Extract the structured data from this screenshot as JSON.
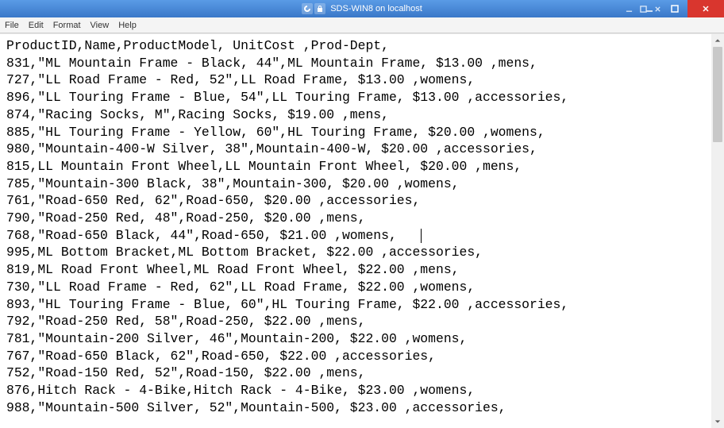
{
  "window": {
    "title": "SDS-WIN8 on localhost"
  },
  "menubar": {
    "items": [
      "File",
      "Edit",
      "Format",
      "View",
      "Help"
    ]
  },
  "csv": {
    "header": [
      "ProductID",
      "Name",
      "ProductModel",
      " UnitCost ",
      "Prod-Dept",
      ""
    ],
    "rows": [
      {
        "id": "831",
        "name": "ML Mountain Frame - Black, 44",
        "nameQuoted": true,
        "model": "ML Mountain Frame",
        "cost": "$13.00",
        "dept": "mens"
      },
      {
        "id": "727",
        "name": "LL Road Frame - Red, 52",
        "nameQuoted": true,
        "model": "LL Road Frame",
        "cost": "$13.00",
        "dept": "womens"
      },
      {
        "id": "896",
        "name": "LL Touring Frame - Blue, 54",
        "nameQuoted": true,
        "model": "LL Touring Frame",
        "cost": "$13.00",
        "dept": "accessories"
      },
      {
        "id": "874",
        "name": "Racing Socks, M",
        "nameQuoted": true,
        "model": "Racing Socks",
        "cost": "$19.00",
        "dept": "mens"
      },
      {
        "id": "885",
        "name": "HL Touring Frame - Yellow, 60",
        "nameQuoted": true,
        "model": "HL Touring Frame",
        "cost": "$20.00",
        "dept": "womens"
      },
      {
        "id": "980",
        "name": "Mountain-400-W Silver, 38",
        "nameQuoted": true,
        "model": "Mountain-400-W",
        "cost": "$20.00",
        "dept": "accessories"
      },
      {
        "id": "815",
        "name": "LL Mountain Front Wheel",
        "nameQuoted": false,
        "model": "LL Mountain Front Wheel",
        "cost": "$20.00",
        "dept": "mens"
      },
      {
        "id": "785",
        "name": "Mountain-300 Black, 38",
        "nameQuoted": true,
        "model": "Mountain-300",
        "cost": "$20.00",
        "dept": "womens"
      },
      {
        "id": "761",
        "name": "Road-650 Red, 62",
        "nameQuoted": true,
        "model": "Road-650",
        "cost": "$20.00",
        "dept": "accessories"
      },
      {
        "id": "790",
        "name": "Road-250 Red, 48",
        "nameQuoted": true,
        "model": "Road-250",
        "cost": "$20.00",
        "dept": "mens"
      },
      {
        "id": "768",
        "name": "Road-650 Black, 44",
        "nameQuoted": true,
        "model": "Road-650",
        "cost": "$21.00",
        "dept": "womens"
      },
      {
        "id": "995",
        "name": "ML Bottom Bracket",
        "nameQuoted": false,
        "model": "ML Bottom Bracket",
        "cost": "$22.00",
        "dept": "accessories"
      },
      {
        "id": "819",
        "name": "ML Road Front Wheel",
        "nameQuoted": false,
        "model": "ML Road Front Wheel",
        "cost": "$22.00",
        "dept": "mens"
      },
      {
        "id": "730",
        "name": "LL Road Frame - Red, 62",
        "nameQuoted": true,
        "model": "LL Road Frame",
        "cost": "$22.00",
        "dept": "womens"
      },
      {
        "id": "893",
        "name": "HL Touring Frame - Blue, 60",
        "nameQuoted": true,
        "model": "HL Touring Frame",
        "cost": "$22.00",
        "dept": "accessories"
      },
      {
        "id": "792",
        "name": "Road-250 Red, 58",
        "nameQuoted": true,
        "model": "Road-250",
        "cost": "$22.00",
        "dept": "mens"
      },
      {
        "id": "781",
        "name": "Mountain-200 Silver, 46",
        "nameQuoted": true,
        "model": "Mountain-200",
        "cost": "$22.00",
        "dept": "womens"
      },
      {
        "id": "767",
        "name": "Road-650 Black, 62",
        "nameQuoted": true,
        "model": "Road-650",
        "cost": "$22.00",
        "dept": "accessories"
      },
      {
        "id": "752",
        "name": "Road-150 Red, 52",
        "nameQuoted": true,
        "model": "Road-150",
        "cost": "$22.00",
        "dept": "mens"
      },
      {
        "id": "876",
        "name": "Hitch Rack - 4-Bike",
        "nameQuoted": false,
        "model": "Hitch Rack - 4-Bike",
        "cost": "$23.00",
        "dept": "womens"
      },
      {
        "id": "988",
        "name": "Mountain-500 Silver, 52",
        "nameQuoted": true,
        "model": "Mountain-500",
        "cost": "$23.00",
        "dept": "accessories"
      }
    ]
  },
  "caret": {
    "line": 11,
    "col_text": "after womens, trailing"
  }
}
